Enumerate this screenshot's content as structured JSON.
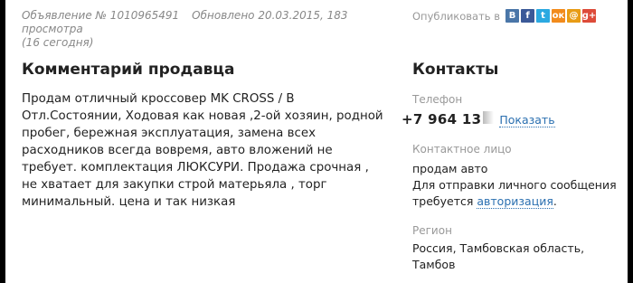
{
  "meta": {
    "ad_number": "Объявление № 1010965491",
    "updated": "Обновлено 20.03.2015, 183 просмотра",
    "today": "(16 сегодня)"
  },
  "publish": {
    "label": "Опубликовать в",
    "networks": [
      {
        "name": "vkontakte",
        "glyph": "B",
        "color": "#4a76a8"
      },
      {
        "name": "facebook",
        "glyph": "f",
        "color": "#3b5998"
      },
      {
        "name": "twitter",
        "glyph": "t",
        "color": "#2ba9e1"
      },
      {
        "name": "odnoklassniki",
        "glyph": "ок",
        "color": "#f28b1c"
      },
      {
        "name": "mail-ru",
        "glyph": "@",
        "color": "#e89c15"
      },
      {
        "name": "google-plus",
        "glyph": "g+",
        "color": "#dd4b39"
      }
    ]
  },
  "comment": {
    "title": "Комментарий продавца",
    "text": "Продам отличный кроссовер MK CROSS / В Отл.Состоянии, Ходовая как новая ,2-ой хозяин, родной пробег, бережная эксплуатация, замена всех расходников всегда вовремя, авто вложений не требует. комплектация ЛЮКСУРИ. Продажа срочная , не хватает для закупки строй матерьяла , торг минимальный. цена и так низкая"
  },
  "contacts": {
    "title": "Контакты",
    "phone_label": "Телефон",
    "phone_partial": "+7 964 13",
    "show_label": "Показать",
    "contact_label": "Контактное лицо",
    "contact_name": "продам авто",
    "message_text": "Для отправки личного сообщения требуется",
    "auth_link": "авторизация",
    "auth_suffix": ".",
    "region_label": "Регион",
    "region_value": "Россия, Тамбовская область, Тамбов"
  }
}
